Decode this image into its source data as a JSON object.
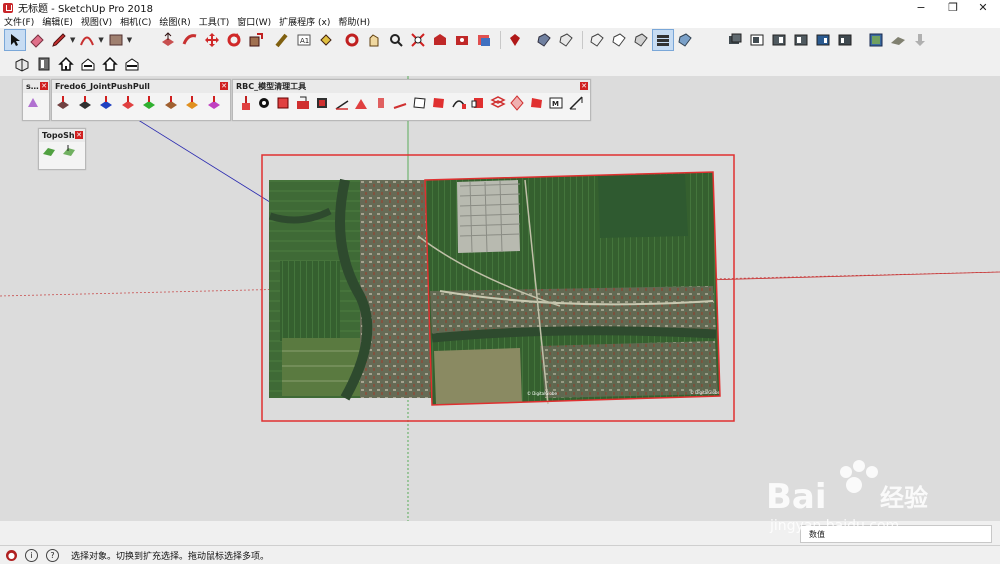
{
  "window": {
    "title": "无标题 - SketchUp Pro 2018",
    "minimize": "−",
    "maximize": "❐",
    "close": "✕"
  },
  "menu": [
    "文件(F)",
    "编辑(E)",
    "视图(V)",
    "相机(C)",
    "绘图(R)",
    "工具(T)",
    "窗口(W)",
    "扩展程序 (x)",
    "帮助(H)"
  ],
  "toolbar": {
    "main_tools": [
      "select-icon",
      "eraser-icon",
      "pencil-icon",
      "arc-icon",
      "rectangle-icon",
      "push-pull-icon",
      "follow-me-icon",
      "move-icon",
      "rotate-icon",
      "scale-icon",
      "tape-measure-icon",
      "text-icon",
      "paint-bucket-icon",
      "orbit-icon",
      "pan-icon",
      "zoom-icon",
      "zoom-extents-icon",
      "warehouse-icon",
      "extension-warehouse-icon",
      "layout-icon",
      "ruby-icon"
    ],
    "style_tools": [
      "xray-icon",
      "back-edges-icon",
      "wireframe-icon",
      "hidden-line-icon",
      "shaded-icon",
      "shaded-textures-icon",
      "monochrome-icon"
    ],
    "view_tools": [
      "iso-view-icon",
      "top-view-icon",
      "front-view-icon",
      "right-view-icon",
      "back-view-icon",
      "left-view-icon"
    ],
    "geo_tools": [
      "add-location-icon",
      "toggle-terrain-icon",
      "photo-texture-icon"
    ],
    "row2_tools": [
      "components-icon",
      "section-icon",
      "house-icon",
      "warehouse-share-icon",
      "house-outline-icon",
      "house-cutaway-icon"
    ]
  },
  "panels": {
    "small": {
      "title": "s…"
    },
    "fredo": {
      "title": "Fredo6_JointPushPull"
    },
    "rbc": {
      "title": "RBC_模型清理工具"
    },
    "topo": {
      "title": "TopoSh…"
    }
  },
  "image_label_1": "© DigitalGlobe",
  "image_label_2": "© DigitalGlobe",
  "status": {
    "text": "选择对象。切换到扩充选择。拖动鼠标选择多项。",
    "measure_label": "数值"
  },
  "watermark": {
    "brand": "Bai",
    "brand2": "经验",
    "url": "jingyan.baidu.com"
  },
  "colors": {
    "accent_blue": "#c7dcf3",
    "panel_close": "#d02020",
    "selection_red": "#e03030",
    "axis_red": "#c83232",
    "axis_green": "#3aa03a",
    "axis_blue": "#2b2bb0"
  }
}
